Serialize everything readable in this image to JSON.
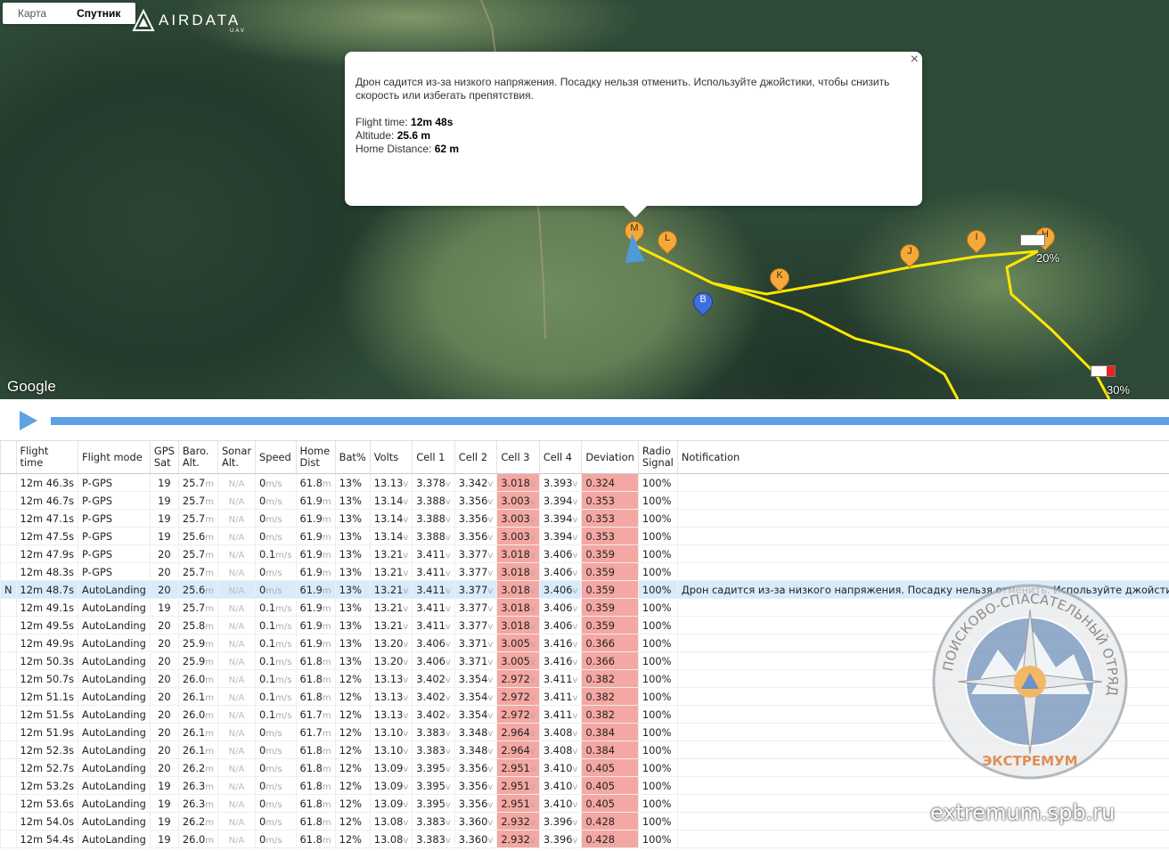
{
  "map": {
    "tabs": [
      {
        "label": "Карта",
        "active": false
      },
      {
        "label": "Спутник",
        "active": true
      }
    ],
    "brand": {
      "name": "AIRDATA",
      "sub": "UAV"
    },
    "google_label": "Google",
    "popup": {
      "message": "Дрон садится из-за низкого напряжения. Посадку нельзя отменить. Используйте джойстики, чтобы снизить скорость или избегать препятствия.",
      "flight_time_label": "Flight time:",
      "flight_time": "12m 48s",
      "altitude_label": "Altitude:",
      "altitude": "25.6 m",
      "home_distance_label": "Home Distance:",
      "home_distance": "62 m",
      "close": "×"
    },
    "markers": [
      "M",
      "L",
      "K",
      "J",
      "I",
      "H",
      "B"
    ],
    "battery_labels": [
      "20%",
      "30%"
    ],
    "colors": {
      "track": "#ffe600",
      "marker": "#f5a93a",
      "home_marker": "#3f6ee0",
      "player": "#5ea1e4"
    }
  },
  "player": {
    "play_icon": "play-icon"
  },
  "table": {
    "columns": [
      "",
      "Flight time",
      "Flight mode",
      "GPS Sat",
      "Baro. Alt.",
      "Sonar Alt.",
      "Speed",
      "Home Dist",
      "Bat%",
      "Volts",
      "Cell 1",
      "Cell 2",
      "Cell 3",
      "Cell 4",
      "Deviation",
      "Radio Signal",
      "Notification"
    ],
    "units": {
      "alt": "m",
      "speed": "m/s",
      "dist": "m",
      "volt": "v"
    },
    "na": "N/A",
    "rows": [
      {
        "flag": "",
        "time": "12m 46.3s",
        "mode": "P-GPS",
        "sat": "19",
        "baro": "25.7",
        "sonar": "N/A",
        "speed": "0",
        "dist": "61.8",
        "bat": "13%",
        "volts": "13.13",
        "c1": "3.378",
        "c2": "3.342",
        "c3": "3.018",
        "c4": "3.393",
        "dev": "0.324",
        "radio": "100%",
        "note": ""
      },
      {
        "flag": "",
        "time": "12m 46.7s",
        "mode": "P-GPS",
        "sat": "19",
        "baro": "25.7",
        "sonar": "N/A",
        "speed": "0",
        "dist": "61.9",
        "bat": "13%",
        "volts": "13.14",
        "c1": "3.388",
        "c2": "3.356",
        "c3": "3.003",
        "c4": "3.394",
        "dev": "0.353",
        "radio": "100%",
        "note": ""
      },
      {
        "flag": "",
        "time": "12m 47.1s",
        "mode": "P-GPS",
        "sat": "19",
        "baro": "25.7",
        "sonar": "N/A",
        "speed": "0",
        "dist": "61.9",
        "bat": "13%",
        "volts": "13.14",
        "c1": "3.388",
        "c2": "3.356",
        "c3": "3.003",
        "c4": "3.394",
        "dev": "0.353",
        "radio": "100%",
        "note": ""
      },
      {
        "flag": "",
        "time": "12m 47.5s",
        "mode": "P-GPS",
        "sat": "19",
        "baro": "25.6",
        "sonar": "N/A",
        "speed": "0",
        "dist": "61.9",
        "bat": "13%",
        "volts": "13.14",
        "c1": "3.388",
        "c2": "3.356",
        "c3": "3.003",
        "c4": "3.394",
        "dev": "0.353",
        "radio": "100%",
        "note": ""
      },
      {
        "flag": "",
        "time": "12m 47.9s",
        "mode": "P-GPS",
        "sat": "20",
        "baro": "25.7",
        "sonar": "N/A",
        "speed": "0.1",
        "dist": "61.9",
        "bat": "13%",
        "volts": "13.21",
        "c1": "3.411",
        "c2": "3.377",
        "c3": "3.018",
        "c4": "3.406",
        "dev": "0.359",
        "radio": "100%",
        "note": ""
      },
      {
        "flag": "",
        "time": "12m 48.3s",
        "mode": "P-GPS",
        "sat": "20",
        "baro": "25.7",
        "sonar": "N/A",
        "speed": "0",
        "dist": "61.9",
        "bat": "13%",
        "volts": "13.21",
        "c1": "3.411",
        "c2": "3.377",
        "c3": "3.018",
        "c4": "3.406",
        "dev": "0.359",
        "radio": "100%",
        "note": ""
      },
      {
        "flag": "N",
        "time": "12m 48.7s",
        "mode": "AutoLanding",
        "sat": "20",
        "baro": "25.6",
        "sonar": "N/A",
        "speed": "0",
        "dist": "61.9",
        "bat": "13%",
        "volts": "13.21",
        "c1": "3.411",
        "c2": "3.377",
        "c3": "3.018",
        "c4": "3.406",
        "dev": "0.359",
        "radio": "100%",
        "note": "Дрон садится из-за низкого напряжения. Посадку нельзя отменить. Используйте джойстики",
        "highlight": true
      },
      {
        "flag": "",
        "time": "12m 49.1s",
        "mode": "AutoLanding",
        "sat": "19",
        "baro": "25.7",
        "sonar": "N/A",
        "speed": "0.1",
        "dist": "61.9",
        "bat": "13%",
        "volts": "13.21",
        "c1": "3.411",
        "c2": "3.377",
        "c3": "3.018",
        "c4": "3.406",
        "dev": "0.359",
        "radio": "100%",
        "note": ""
      },
      {
        "flag": "",
        "time": "12m 49.5s",
        "mode": "AutoLanding",
        "sat": "20",
        "baro": "25.8",
        "sonar": "N/A",
        "speed": "0.1",
        "dist": "61.9",
        "bat": "13%",
        "volts": "13.21",
        "c1": "3.411",
        "c2": "3.377",
        "c3": "3.018",
        "c4": "3.406",
        "dev": "0.359",
        "radio": "100%",
        "note": ""
      },
      {
        "flag": "",
        "time": "12m 49.9s",
        "mode": "AutoLanding",
        "sat": "20",
        "baro": "25.9",
        "sonar": "N/A",
        "speed": "0.1",
        "dist": "61.9",
        "bat": "13%",
        "volts": "13.20",
        "c1": "3.406",
        "c2": "3.371",
        "c3": "3.005",
        "c4": "3.416",
        "dev": "0.366",
        "radio": "100%",
        "note": ""
      },
      {
        "flag": "",
        "time": "12m 50.3s",
        "mode": "AutoLanding",
        "sat": "20",
        "baro": "25.9",
        "sonar": "N/A",
        "speed": "0.1",
        "dist": "61.8",
        "bat": "13%",
        "volts": "13.20",
        "c1": "3.406",
        "c2": "3.371",
        "c3": "3.005",
        "c4": "3.416",
        "dev": "0.366",
        "radio": "100%",
        "note": ""
      },
      {
        "flag": "",
        "time": "12m 50.7s",
        "mode": "AutoLanding",
        "sat": "20",
        "baro": "26.0",
        "sonar": "N/A",
        "speed": "0.1",
        "dist": "61.8",
        "bat": "12%",
        "volts": "13.13",
        "c1": "3.402",
        "c2": "3.354",
        "c3": "2.972",
        "c4": "3.411",
        "dev": "0.382",
        "radio": "100%",
        "note": ""
      },
      {
        "flag": "",
        "time": "12m 51.1s",
        "mode": "AutoLanding",
        "sat": "20",
        "baro": "26.1",
        "sonar": "N/A",
        "speed": "0.1",
        "dist": "61.8",
        "bat": "12%",
        "volts": "13.13",
        "c1": "3.402",
        "c2": "3.354",
        "c3": "2.972",
        "c4": "3.411",
        "dev": "0.382",
        "radio": "100%",
        "note": ""
      },
      {
        "flag": "",
        "time": "12m 51.5s",
        "mode": "AutoLanding",
        "sat": "20",
        "baro": "26.0",
        "sonar": "N/A",
        "speed": "0.1",
        "dist": "61.7",
        "bat": "12%",
        "volts": "13.13",
        "c1": "3.402",
        "c2": "3.354",
        "c3": "2.972",
        "c4": "3.411",
        "dev": "0.382",
        "radio": "100%",
        "note": ""
      },
      {
        "flag": "",
        "time": "12m 51.9s",
        "mode": "AutoLanding",
        "sat": "20",
        "baro": "26.1",
        "sonar": "N/A",
        "speed": "0",
        "dist": "61.7",
        "bat": "12%",
        "volts": "13.10",
        "c1": "3.383",
        "c2": "3.348",
        "c3": "2.964",
        "c4": "3.408",
        "dev": "0.384",
        "radio": "100%",
        "note": ""
      },
      {
        "flag": "",
        "time": "12m 52.3s",
        "mode": "AutoLanding",
        "sat": "20",
        "baro": "26.1",
        "sonar": "N/A",
        "speed": "0",
        "dist": "61.8",
        "bat": "12%",
        "volts": "13.10",
        "c1": "3.383",
        "c2": "3.348",
        "c3": "2.964",
        "c4": "3.408",
        "dev": "0.384",
        "radio": "100%",
        "note": ""
      },
      {
        "flag": "",
        "time": "12m 52.7s",
        "mode": "AutoLanding",
        "sat": "20",
        "baro": "26.2",
        "sonar": "N/A",
        "speed": "0",
        "dist": "61.8",
        "bat": "12%",
        "volts": "13.09",
        "c1": "3.395",
        "c2": "3.356",
        "c3": "2.951",
        "c4": "3.410",
        "dev": "0.405",
        "radio": "100%",
        "note": ""
      },
      {
        "flag": "",
        "time": "12m 53.2s",
        "mode": "AutoLanding",
        "sat": "19",
        "baro": "26.3",
        "sonar": "N/A",
        "speed": "0",
        "dist": "61.8",
        "bat": "12%",
        "volts": "13.09",
        "c1": "3.395",
        "c2": "3.356",
        "c3": "2.951",
        "c4": "3.410",
        "dev": "0.405",
        "radio": "100%",
        "note": ""
      },
      {
        "flag": "",
        "time": "12m 53.6s",
        "mode": "AutoLanding",
        "sat": "19",
        "baro": "26.3",
        "sonar": "N/A",
        "speed": "0",
        "dist": "61.8",
        "bat": "12%",
        "volts": "13.09",
        "c1": "3.395",
        "c2": "3.356",
        "c3": "2.951",
        "c4": "3.410",
        "dev": "0.405",
        "radio": "100%",
        "note": ""
      },
      {
        "flag": "",
        "time": "12m 54.0s",
        "mode": "AutoLanding",
        "sat": "19",
        "baro": "26.2",
        "sonar": "N/A",
        "speed": "0",
        "dist": "61.8",
        "bat": "12%",
        "volts": "13.08",
        "c1": "3.383",
        "c2": "3.360",
        "c3": "2.932",
        "c4": "3.396",
        "dev": "0.428",
        "radio": "100%",
        "note": ""
      },
      {
        "flag": "",
        "time": "12m 54.4s",
        "mode": "AutoLanding",
        "sat": "19",
        "baro": "26.0",
        "sonar": "N/A",
        "speed": "0",
        "dist": "61.8",
        "bat": "12%",
        "volts": "13.08",
        "c1": "3.383",
        "c2": "3.360",
        "c3": "2.932",
        "c4": "3.396",
        "dev": "0.428",
        "radio": "100%",
        "note": ""
      }
    ]
  },
  "watermark": {
    "ring_text": "ПОИСКОВО-СПАСАТЕЛЬНЫЙ ОТРЯД",
    "bottom_text": "ЭКСТРЕМУМ",
    "site": "extremum.spb.ru"
  }
}
